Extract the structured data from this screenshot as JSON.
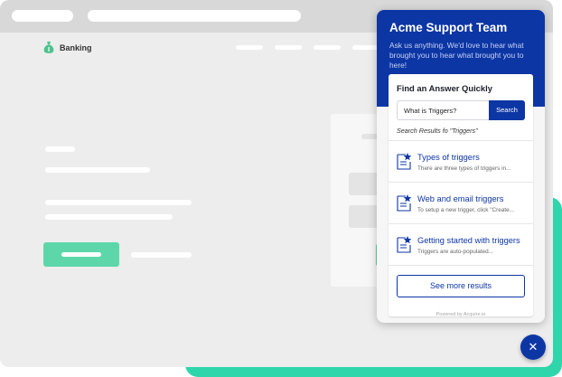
{
  "brand": {
    "name": "Banking"
  },
  "widget": {
    "title": "Acme Support Team",
    "subtitle": "Ask us anything. We'd love to hear what brought you to hear what brought you to here!",
    "section_title": "Find an Answer Quickly",
    "search": {
      "value": "What is Triggers?",
      "button_label": "Search"
    },
    "results_caption": "Search Results fo \"Triggers\"",
    "results": [
      {
        "title": "Types of triggers",
        "desc": "There are three types of triggers in...",
        "icon": "article-star-icon"
      },
      {
        "title": "Web and email triggers",
        "desc": "To setup a new trigger, click \"Create...",
        "icon": "article-star-icon"
      },
      {
        "title": "Getting started with triggers",
        "desc": "Triggers are auto-populated...",
        "icon": "article-star-icon"
      }
    ],
    "see_more_label": "See more results",
    "powered_by": "Powered by Acquire.io",
    "close_icon": "close-icon"
  },
  "colors": {
    "primary": "#0d36a5",
    "accent": "#2fd6ab",
    "cta": "#5dd7a9"
  }
}
